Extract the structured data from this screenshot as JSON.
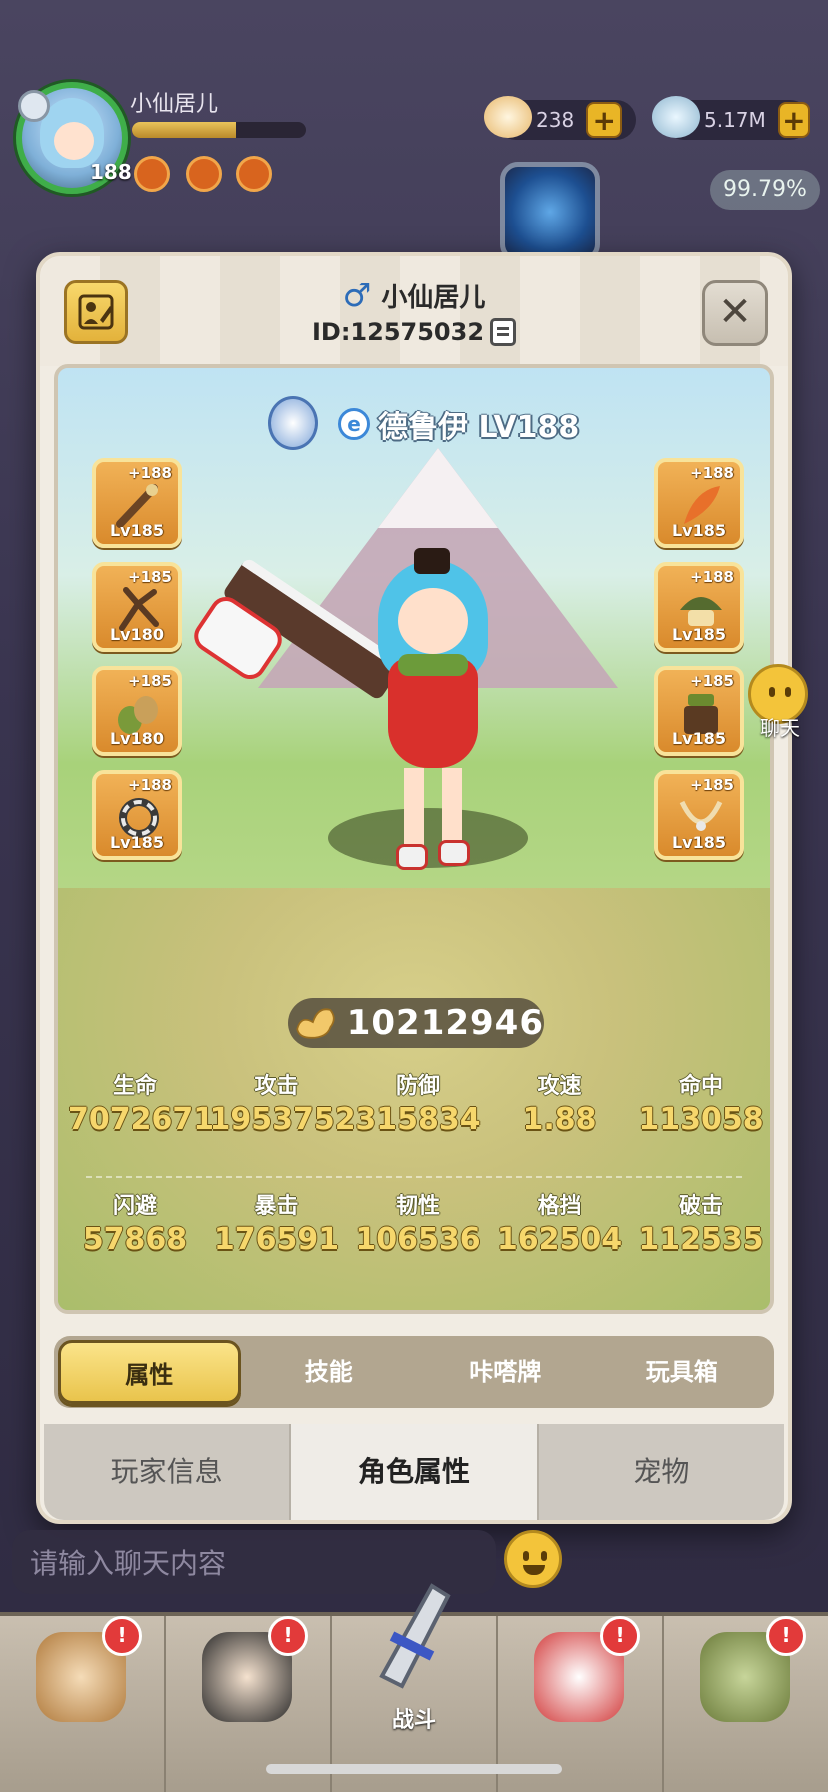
{
  "hud": {
    "player_name": "小仙居儿",
    "level": "188",
    "xp_fraction": 0.6,
    "currency_1": "238",
    "currency_2": "5.17M",
    "plus": "+",
    "percent": "99.79%"
  },
  "profile": {
    "gender_icon": "male-icon",
    "name": "小仙居儿",
    "id": "ID:12575032",
    "class_name": "德鲁伊 LV188",
    "power": "10212946"
  },
  "equipment": {
    "left": [
      {
        "icon": "staff-icon",
        "plus": "+188",
        "level": "Lv185"
      },
      {
        "icon": "antler-icon",
        "plus": "+185",
        "level": "Lv180"
      },
      {
        "icon": "bracer-icon",
        "plus": "+185",
        "level": "Lv180"
      },
      {
        "icon": "ring-icon",
        "plus": "+188",
        "level": "Lv185"
      }
    ],
    "right": [
      {
        "icon": "feather-icon",
        "plus": "+188",
        "level": "Lv185"
      },
      {
        "icon": "helmet-icon",
        "plus": "+188",
        "level": "Lv185"
      },
      {
        "icon": "armor-icon",
        "plus": "+185",
        "level": "Lv185"
      },
      {
        "icon": "necklace-icon",
        "plus": "+185",
        "level": "Lv185"
      }
    ]
  },
  "stats": {
    "row1": [
      {
        "label": "生命",
        "value": "7072671"
      },
      {
        "label": "攻击",
        "value": "1953752"
      },
      {
        "label": "防御",
        "value": "315834"
      },
      {
        "label": "攻速",
        "value": "1.88"
      },
      {
        "label": "命中",
        "value": "113058"
      }
    ],
    "row2": [
      {
        "label": "闪避",
        "value": "57868"
      },
      {
        "label": "暴击",
        "value": "176591"
      },
      {
        "label": "韧性",
        "value": "106536"
      },
      {
        "label": "格挡",
        "value": "162504"
      },
      {
        "label": "破击",
        "value": "112535"
      }
    ]
  },
  "subtabs": [
    "属性",
    "技能",
    "咔嗒牌",
    "玩具箱"
  ],
  "tabs": [
    "玩家信息",
    "角色属性",
    "宠物"
  ],
  "close": "✕",
  "chat": {
    "label": "聊天",
    "placeholder": "请输入聊天内容"
  },
  "nav": {
    "battle_label": "战斗",
    "alert": "!"
  },
  "colors": {
    "accent_gold": "#e9c44c",
    "stat_value": "#f6d76c",
    "slot_orange": "#d98a2c"
  }
}
